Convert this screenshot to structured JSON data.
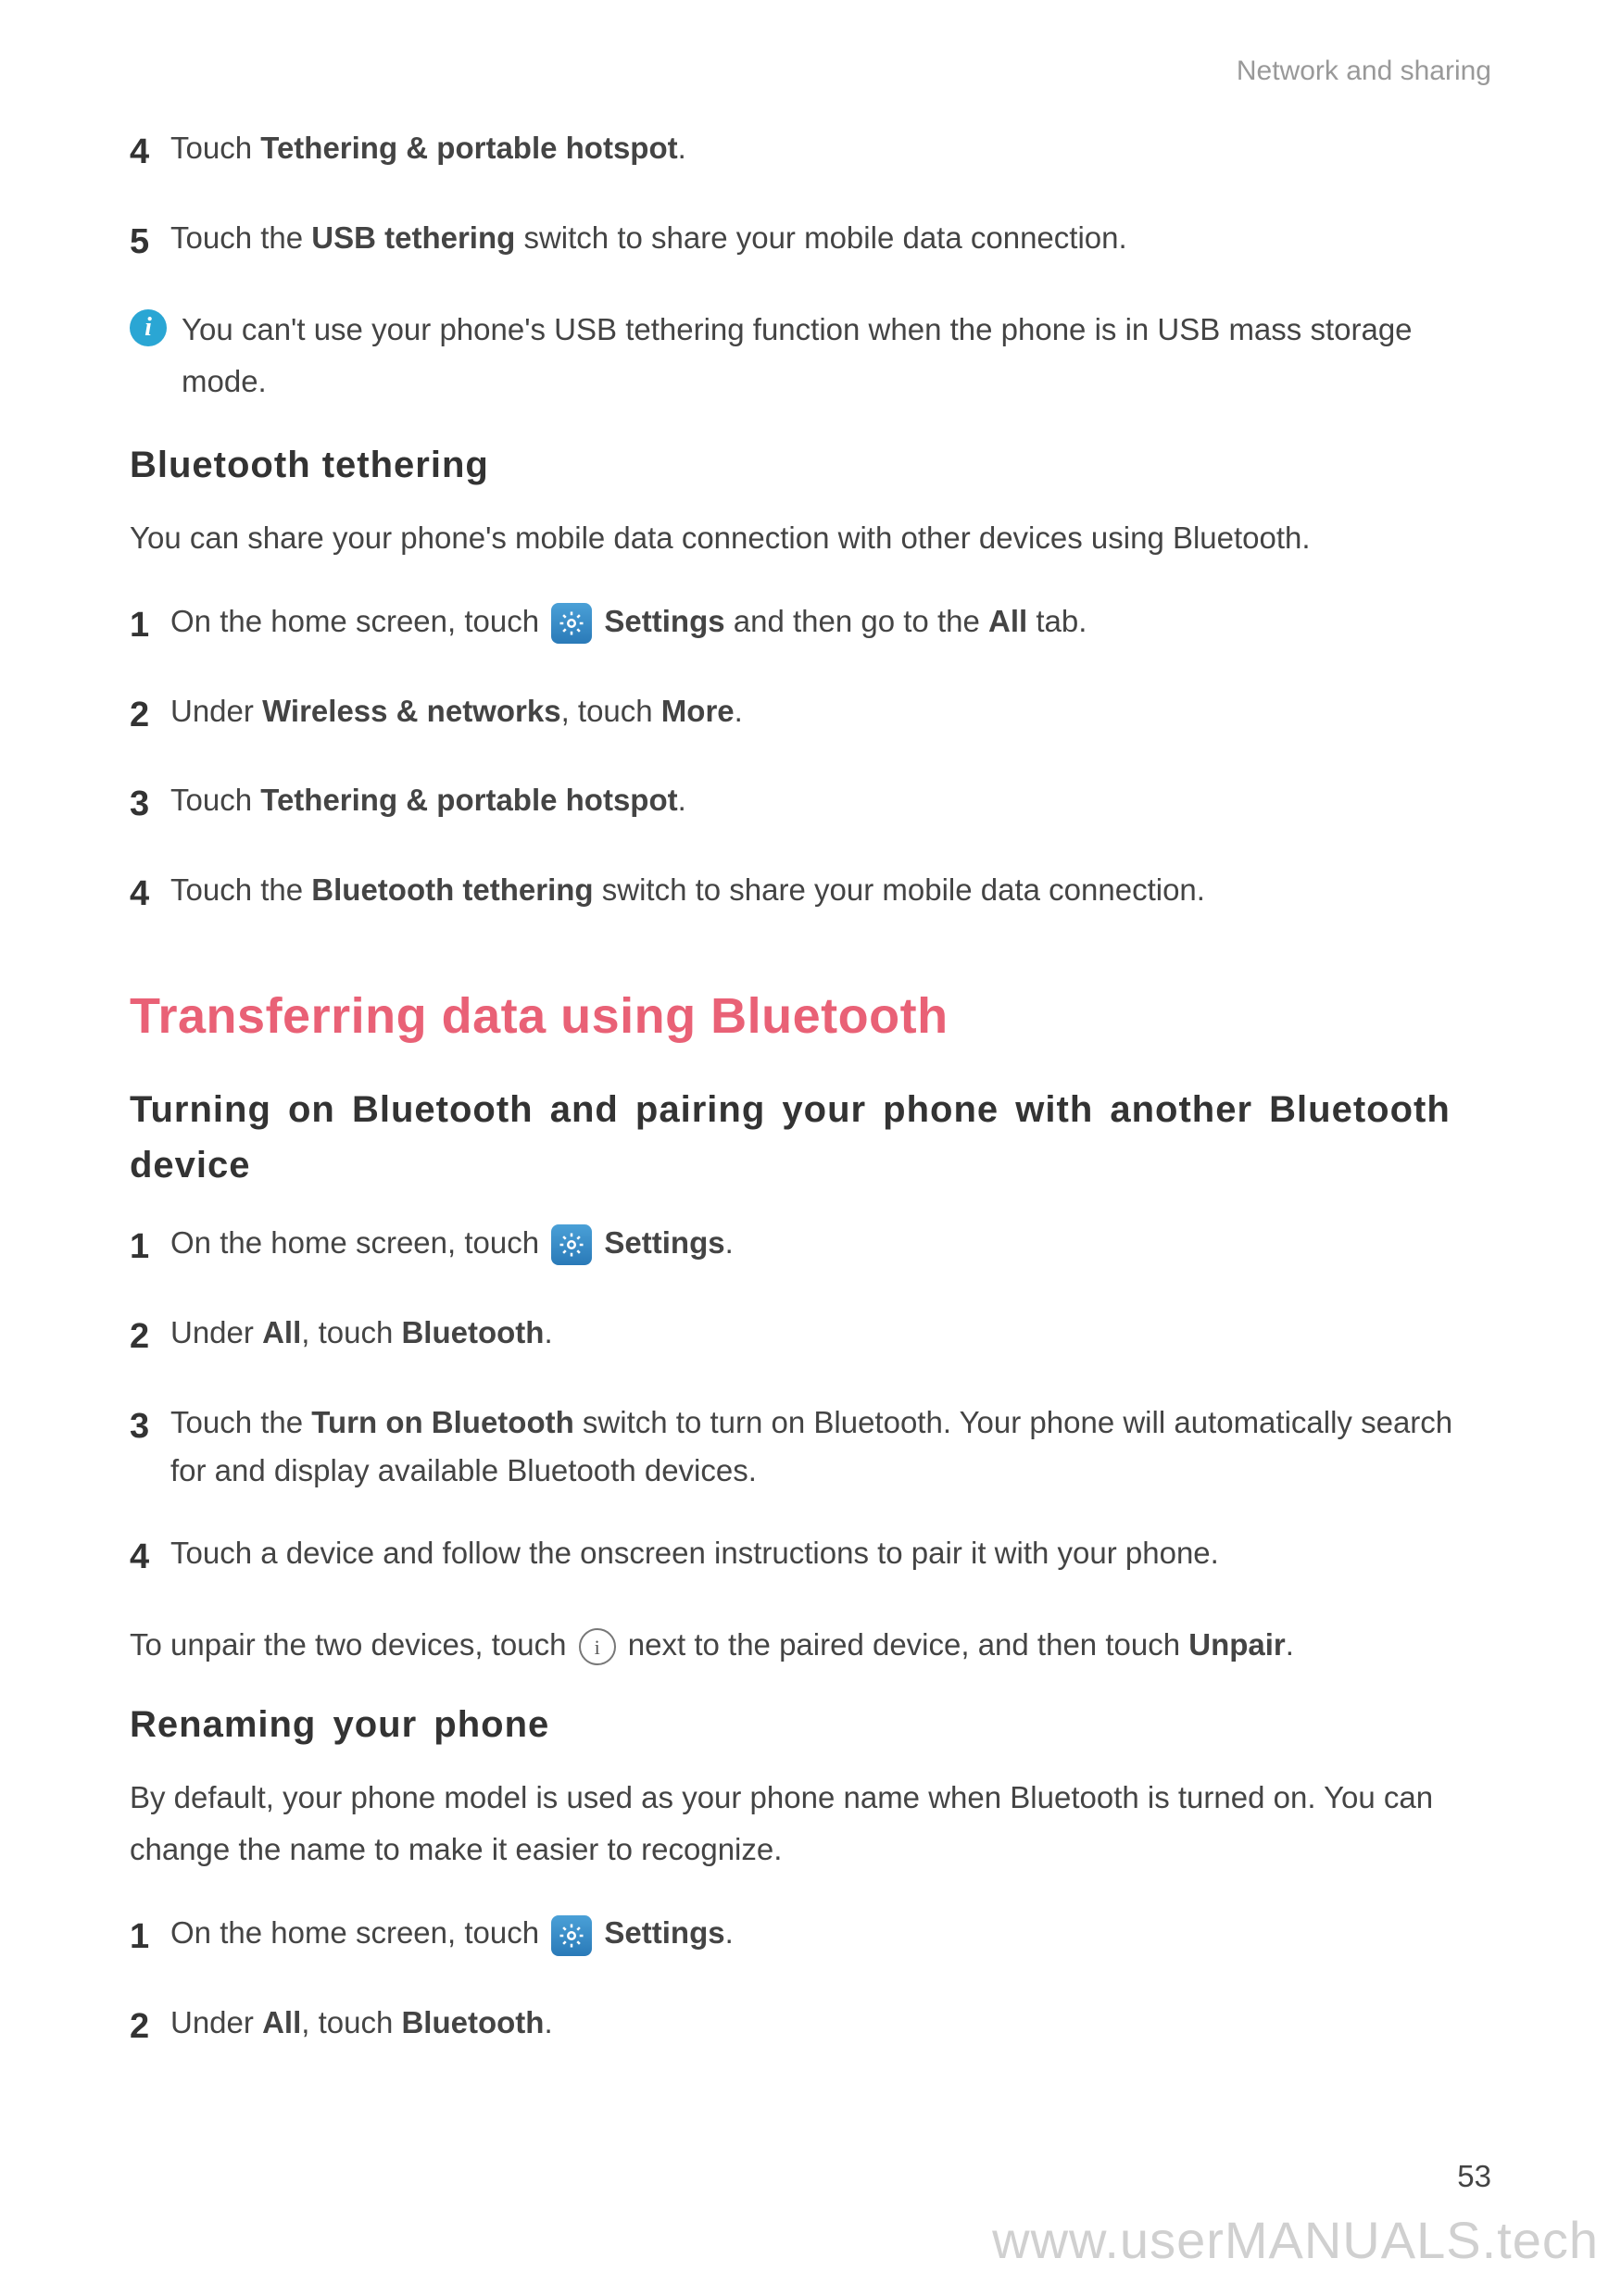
{
  "header": {
    "title": "Network and sharing"
  },
  "topSteps": {
    "s4": {
      "num": "4",
      "pre": "Touch ",
      "bold": "Tethering & portable hotspot",
      "post": "."
    },
    "s5": {
      "num": "5",
      "pre": "Touch the ",
      "bold": "USB tethering",
      "post": " switch to share your mobile data connection."
    }
  },
  "info1": "You can't use your phone's USB tethering function when the phone is in USB mass storage mode.",
  "bt_tether": {
    "heading": "Bluetooth tethering",
    "intro": "You can share your phone's mobile data connection with other devices using Bluetooth.",
    "s1": {
      "num": "1",
      "pre": "On the home screen, touch ",
      "boldA": "Settings",
      "mid": " and then go to the ",
      "boldB": "All",
      "post": " tab."
    },
    "s2": {
      "num": "2",
      "pre": "Under ",
      "boldA": "Wireless & networks",
      "mid": ", touch ",
      "boldB": "More",
      "post": "."
    },
    "s3": {
      "num": "3",
      "pre": "Touch ",
      "boldA": "Tethering & portable hotspot",
      "post": "."
    },
    "s4": {
      "num": "4",
      "pre": "Touch the ",
      "boldA": "Bluetooth tethering",
      "post": " switch to share your mobile data connection."
    }
  },
  "transfer": {
    "heading": "Transferring data using Bluetooth",
    "pairing": {
      "heading": "Turning on Bluetooth and pairing your phone with another Bluetooth device",
      "s1": {
        "num": "1",
        "pre": "On the home screen, touch ",
        "bold": "Settings",
        "post": "."
      },
      "s2": {
        "num": "2",
        "pre": "Under ",
        "boldA": "All",
        "mid": ", touch ",
        "boldB": "Bluetooth",
        "post": "."
      },
      "s3": {
        "num": "3",
        "pre": "Touch the ",
        "bold": "Turn on Bluetooth",
        "post": " switch to turn on Bluetooth. Your phone will automatically search for and display available Bluetooth devices."
      },
      "s4": {
        "num": "4",
        "text": "Touch a device and follow the onscreen instructions to pair it with your phone."
      },
      "unpair": {
        "pre": "To unpair the two devices, touch ",
        "mid": " next to the paired device, and then touch ",
        "bold": "Unpair",
        "post": "."
      }
    },
    "rename": {
      "heading": "Renaming your phone",
      "intro": "By default, your phone model is used as your phone name when Bluetooth is turned on. You can change the name to make it easier to recognize.",
      "s1": {
        "num": "1",
        "pre": "On the home screen, touch ",
        "bold": "Settings",
        "post": "."
      },
      "s2": {
        "num": "2",
        "pre": "Under ",
        "boldA": "All",
        "mid": ", touch ",
        "boldB": "Bluetooth",
        "post": "."
      }
    }
  },
  "pageNum": "53",
  "watermark": "www.userMANUALS.tech"
}
